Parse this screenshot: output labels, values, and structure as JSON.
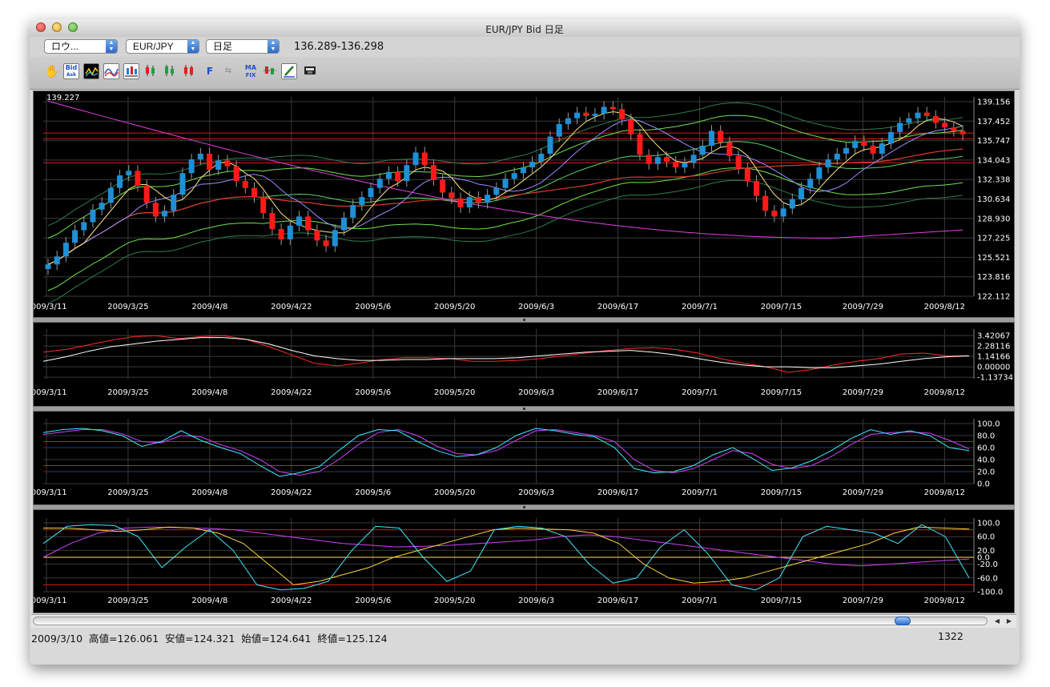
{
  "window": {
    "title": "EUR/JPY Bid 日足"
  },
  "toolbar": {
    "chart_type_select": "ロウ...",
    "pair_select": "EUR/JPY",
    "period_select": "日足",
    "bid_range": "136.289-136.298",
    "tools": [
      {
        "name": "hand-tool",
        "label": ""
      },
      {
        "name": "bid-ask",
        "label": "Bid"
      },
      {
        "name": "bid-ask-sub",
        "label": "Ask"
      },
      {
        "name": "fix",
        "label": "F"
      },
      {
        "name": "ma-fix",
        "label": "MA"
      },
      {
        "name": "ma-fix-sub",
        "label": "FIX"
      }
    ]
  },
  "main_chart": {
    "top_left_value": "139.227",
    "y_ticks": [
      "139.156",
      "137.452",
      "135.747",
      "134.043",
      "132.338",
      "130.634",
      "128.930",
      "127.225",
      "125.521",
      "123.816",
      "122.112"
    ],
    "x_ticks": [
      "2009/3/11",
      "2009/3/25",
      "2009/4/8",
      "2009/4/22",
      "2009/5/6",
      "2009/5/20",
      "2009/6/3",
      "2009/6/17",
      "2009/7/1",
      "2009/7/15",
      "2009/7/29",
      "2009/8/12"
    ],
    "ylim": [
      122.112,
      139.156
    ],
    "ref_lines": [
      135.9,
      133.8,
      136.4
    ],
    "closes": [
      124.9,
      125.6,
      126.8,
      127.9,
      128.6,
      129.7,
      130.3,
      131.6,
      132.7,
      133.1,
      131.8,
      130.3,
      129.1,
      129.6,
      131.0,
      132.9,
      134.1,
      134.6,
      133.2,
      134.0,
      133.5,
      132.2,
      131.6,
      130.8,
      129.4,
      128.0,
      127.1,
      128.3,
      129.1,
      127.9,
      127.0,
      126.5,
      127.9,
      129.0,
      130.1,
      130.8,
      131.6,
      132.4,
      133.0,
      132.2,
      133.6,
      134.7,
      133.6,
      132.3,
      131.2,
      130.7,
      129.9,
      130.8,
      130.3,
      131.0,
      131.6,
      132.4,
      132.9,
      133.4,
      133.9,
      134.6,
      136.1,
      137.2,
      137.7,
      138.2,
      137.9,
      138.1,
      138.7,
      138.5,
      137.6,
      136.3,
      134.5,
      133.7,
      134.3,
      133.9,
      133.4,
      133.8,
      134.5,
      135.3,
      136.6,
      135.6,
      134.4,
      133.3,
      132.2,
      130.9,
      129.6,
      129.1,
      129.8,
      130.6,
      131.6,
      132.4,
      133.4,
      134.1,
      134.6,
      135.1,
      135.7,
      135.3,
      134.6,
      135.5,
      136.5,
      137.3,
      137.7,
      138.2,
      137.9,
      137.3,
      136.9,
      136.6,
      136.3
    ]
  },
  "macd_panel": {
    "y_ticks": [
      "3.42067",
      "2.28116",
      "1.14166",
      "0.00000",
      "-1.13734"
    ],
    "x_ticks": [
      "2009/3/11",
      "2009/3/25",
      "2009/4/8",
      "2009/4/22",
      "2009/5/6",
      "2009/5/20",
      "2009/6/3",
      "2009/6/17",
      "2009/7/1",
      "2009/7/15",
      "2009/7/29",
      "2009/8/12"
    ],
    "ylim": [
      -1.3,
      3.6
    ],
    "series_red": [
      1.6,
      1.9,
      2.4,
      2.9,
      3.3,
      3.4,
      3.1,
      3.3,
      3.4,
      3.0,
      2.2,
      1.3,
      0.4,
      0.1,
      0.4,
      0.8,
      1.0,
      1.0,
      0.9,
      0.6,
      0.6,
      0.7,
      0.9,
      1.2,
      1.5,
      1.8,
      2.0,
      2.1,
      1.9,
      1.5,
      0.9,
      0.4,
      0.0,
      -0.6,
      -0.3,
      0.2,
      0.6,
      0.9,
      1.4,
      1.5,
      1.2,
      1.2
    ],
    "series_white": [
      0.6,
      1.1,
      1.7,
      2.2,
      2.5,
      2.8,
      3.0,
      3.2,
      3.2,
      3.0,
      2.5,
      1.8,
      1.2,
      0.9,
      0.7,
      0.7,
      0.8,
      0.8,
      0.9,
      0.9,
      0.9,
      1.0,
      1.2,
      1.4,
      1.6,
      1.7,
      1.8,
      1.6,
      1.3,
      0.9,
      0.5,
      0.2,
      0.0,
      0.0,
      -0.1,
      -0.1,
      0.1,
      0.3,
      0.6,
      0.9,
      1.1,
      1.2
    ]
  },
  "stoch_panel": {
    "y_ticks": [
      "100.0",
      "80.0",
      "60.0",
      "40.0",
      "20.0",
      "0.0"
    ],
    "x_ticks": [
      "2009/3/11",
      "2009/3/25",
      "2009/4/8",
      "2009/4/22",
      "2009/5/6",
      "2009/5/20",
      "2009/6/3",
      "2009/6/17",
      "2009/7/1",
      "2009/7/15",
      "2009/7/29",
      "2009/8/12"
    ],
    "ylim": [
      0,
      100
    ],
    "levels": [
      70,
      30
    ],
    "series_cyan": [
      85,
      90,
      92,
      88,
      80,
      62,
      70,
      88,
      72,
      60,
      50,
      30,
      12,
      18,
      28,
      55,
      80,
      90,
      88,
      70,
      55,
      45,
      48,
      60,
      80,
      92,
      88,
      82,
      78,
      60,
      25,
      18,
      20,
      30,
      48,
      60,
      42,
      22,
      26,
      38,
      55,
      75,
      90,
      82,
      88,
      80,
      60,
      55
    ],
    "series_magenta": [
      82,
      86,
      90,
      90,
      83,
      70,
      68,
      80,
      78,
      65,
      55,
      40,
      20,
      14,
      20,
      40,
      65,
      85,
      90,
      80,
      62,
      50,
      48,
      55,
      72,
      88,
      90,
      85,
      80,
      70,
      40,
      22,
      18,
      25,
      40,
      55,
      50,
      32,
      25,
      30,
      45,
      65,
      82,
      85,
      86,
      84,
      72,
      58
    ]
  },
  "rci_panel": {
    "y_ticks": [
      "100.0",
      "60.0",
      "20.0",
      "0.0",
      "-20.0",
      "-60.0",
      "-100.0"
    ],
    "x_ticks": [
      "2009/3/11",
      "2009/3/25",
      "2009/4/8",
      "2009/4/22",
      "2009/5/6",
      "2009/5/20",
      "2009/6/3",
      "2009/6/17",
      "2009/7/1",
      "2009/7/15",
      "2009/7/29",
      "2009/8/12"
    ],
    "ylim": [
      -100,
      100
    ],
    "levels": [
      80,
      0,
      -80
    ],
    "series_cyan": [
      40,
      90,
      95,
      92,
      60,
      -30,
      30,
      80,
      20,
      -80,
      -95,
      -90,
      -70,
      20,
      90,
      85,
      0,
      -70,
      -40,
      80,
      90,
      85,
      60,
      -20,
      -75,
      -60,
      30,
      80,
      10,
      -80,
      -95,
      -60,
      60,
      90,
      80,
      70,
      40,
      95,
      60,
      -60
    ],
    "series_yellow": [
      85,
      85,
      80,
      75,
      80,
      88,
      85,
      70,
      40,
      -20,
      -80,
      -70,
      -50,
      -30,
      0,
      20,
      40,
      60,
      80,
      85,
      82,
      80,
      70,
      40,
      -20,
      -60,
      -75,
      -70,
      -60,
      -40,
      -20,
      0,
      20,
      40,
      70,
      88,
      85,
      82
    ],
    "series_magenta": [
      0,
      40,
      70,
      85,
      88,
      86,
      84,
      80,
      70,
      60,
      50,
      40,
      35,
      30,
      32,
      35,
      40,
      45,
      50,
      60,
      65,
      60,
      50,
      40,
      30,
      20,
      10,
      0,
      -10,
      -20,
      -25,
      -20,
      -15,
      -10,
      -5
    ]
  },
  "scrollbar": {
    "left_arrow": "◀",
    "right_arrow": "▶"
  },
  "status": {
    "ohlc": "2009/3/10  高値=126.061  安値=124.321  始値=124.641  終値=125.124",
    "count": "1322"
  },
  "colors": {
    "up": "#1e90d6",
    "down": "#ff1a1a",
    "background": "#000000",
    "grid": "#3a3a3a"
  }
}
